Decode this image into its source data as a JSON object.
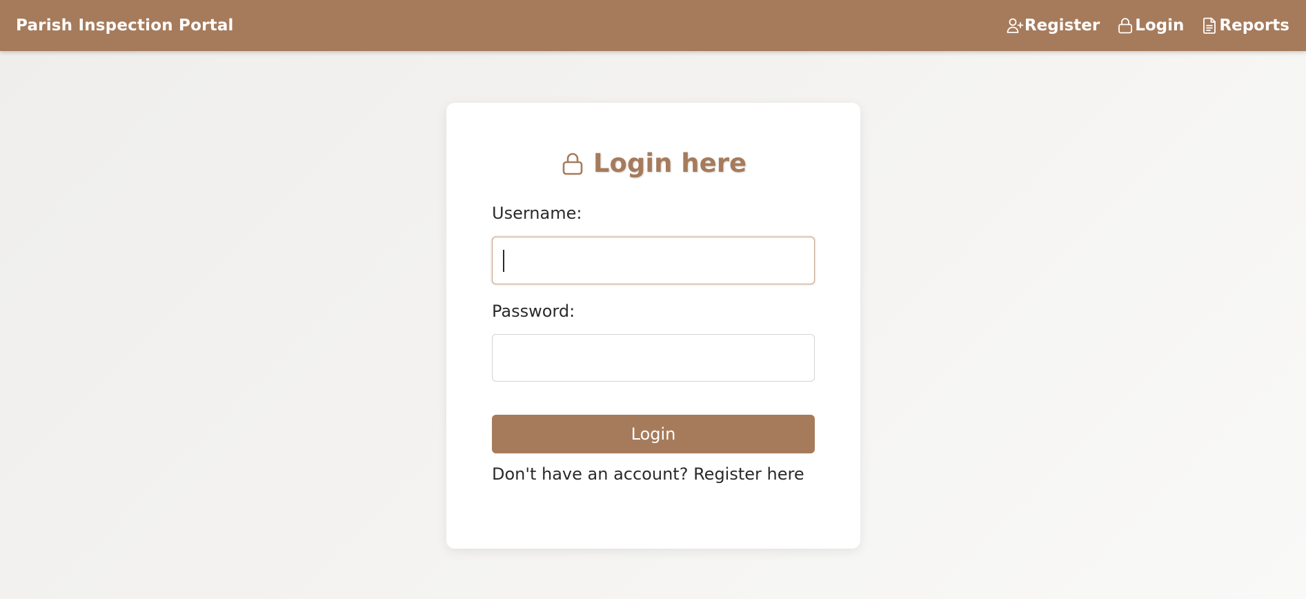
{
  "navbar": {
    "brand": "Parish Inspection Portal",
    "links": [
      {
        "label": "Register",
        "icon": "user-plus-icon"
      },
      {
        "label": "Login",
        "icon": "lock-icon"
      },
      {
        "label": "Reports",
        "icon": "document-icon"
      }
    ]
  },
  "login_card": {
    "title": "Login here",
    "title_icon": "lock-icon",
    "username_label": "Username:",
    "username_value": "",
    "password_label": "Password:",
    "password_value": "",
    "submit_label": "Login",
    "footer_prefix": "Don't have an account?",
    "register_link": "Register here"
  },
  "colors": {
    "primary": "#a67b5b",
    "text": "#2a2a2a",
    "card": "#ffffff"
  }
}
